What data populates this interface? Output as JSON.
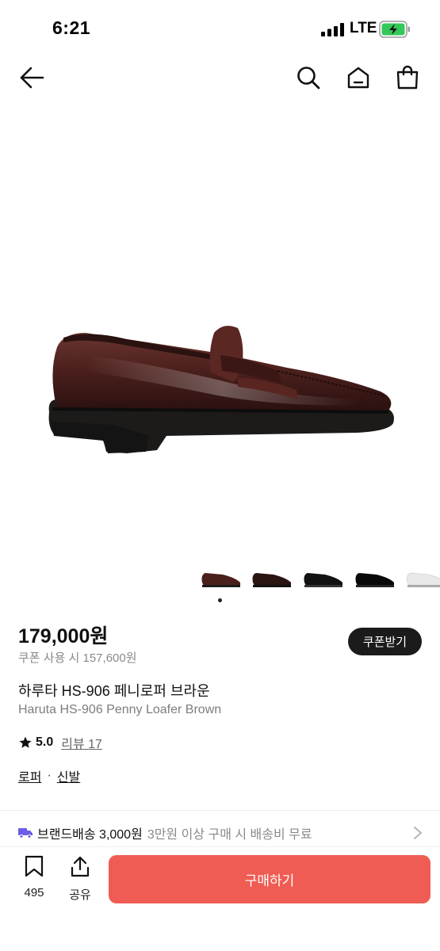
{
  "status_bar": {
    "time": "6:21",
    "network": "LTE",
    "icons": [
      "signal-icon",
      "battery-charging-icon"
    ]
  },
  "nav": {
    "icons": [
      "back-arrow-icon",
      "search-icon",
      "home-icon",
      "shopping-bag-icon"
    ]
  },
  "product": {
    "price": "179,000원",
    "coupon_price": "쿠폰 사용 시 157,600원",
    "coupon_button": "쿠폰받기",
    "name_ko": "하루타 HS-906 페니로퍼 브라운",
    "name_en": "Haruta HS-906 Penny Loafer Brown",
    "rating": "5.0",
    "review_label": "리뷰 17",
    "categories": [
      "로퍼",
      "신발"
    ],
    "category_separator": "·",
    "thumbnails": [
      "brown",
      "dark-brown",
      "black",
      "black-glossy",
      "white"
    ],
    "active_thumbnail_index": 0
  },
  "shipping": {
    "label": "브랜드배송 3,000원",
    "sub": "3만원 이상 구매 시 배송비 무료",
    "icon": "truck-icon"
  },
  "bottom_bar": {
    "bookmark_count": "495",
    "share_label": "공유",
    "buy_label": "구매하기"
  },
  "colors": {
    "accent": "#ef5c53",
    "dark_button": "#1b1b1b",
    "muted_text": "#8a8a8a",
    "truck_icon": "#6c5ce7"
  }
}
